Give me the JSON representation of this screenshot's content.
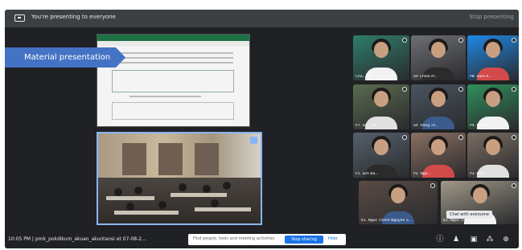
{
  "topbar": {
    "presenting_text": "You're presenting to everyone",
    "stop_presenting": "Stop presenting"
  },
  "slide": {
    "banner": "Material presentation"
  },
  "participants": [
    {
      "name": "Cha... Ba...",
      "color": "#2e7d6b"
    },
    {
      "name": "SP. Chloe Ar...",
      "color": "#6d6f73"
    },
    {
      "name": "P8. Sara A...",
      "color": "#1e88e5"
    },
    {
      "name": "P7. Se... Ma...",
      "color": "#5a6b4f"
    },
    {
      "name": "SP. Trang Th...",
      "color": "#4a5560"
    },
    {
      "name": "P4. Minh Pa...",
      "color": "#2f8f5b"
    },
    {
      "name": "P1. Sim Ba...",
      "color": "#55606a"
    },
    {
      "name": "P2. Nga...",
      "color": "#8a6f60"
    },
    {
      "name": "P3. Bich...",
      "color": "#7b6d62"
    },
    {
      "name": "K1. Ngoc Thanh Nguyen S...",
      "color": "#5a4b44"
    },
    {
      "name": "K1. Ngoc Tran...",
      "color": "#a09889"
    }
  ],
  "bottombar": {
    "time": "10:05 PM",
    "meeting": "pmk_pokdikum_akuan_akuntansi et 07-08-2...",
    "pill_text": "Find people, tools and meeting activities",
    "stop_label": "Stop sharing",
    "hide_label": "Hide",
    "tooltip": "Chat with everyone"
  },
  "controls": [
    {
      "icon": "info-icon",
      "glyph": "ⓘ"
    },
    {
      "icon": "people-icon",
      "glyph": "👥"
    },
    {
      "icon": "chat-icon",
      "glyph": "▣"
    },
    {
      "icon": "activities-icon",
      "glyph": "⁂"
    },
    {
      "icon": "lock-icon",
      "glyph": "🔒"
    }
  ]
}
